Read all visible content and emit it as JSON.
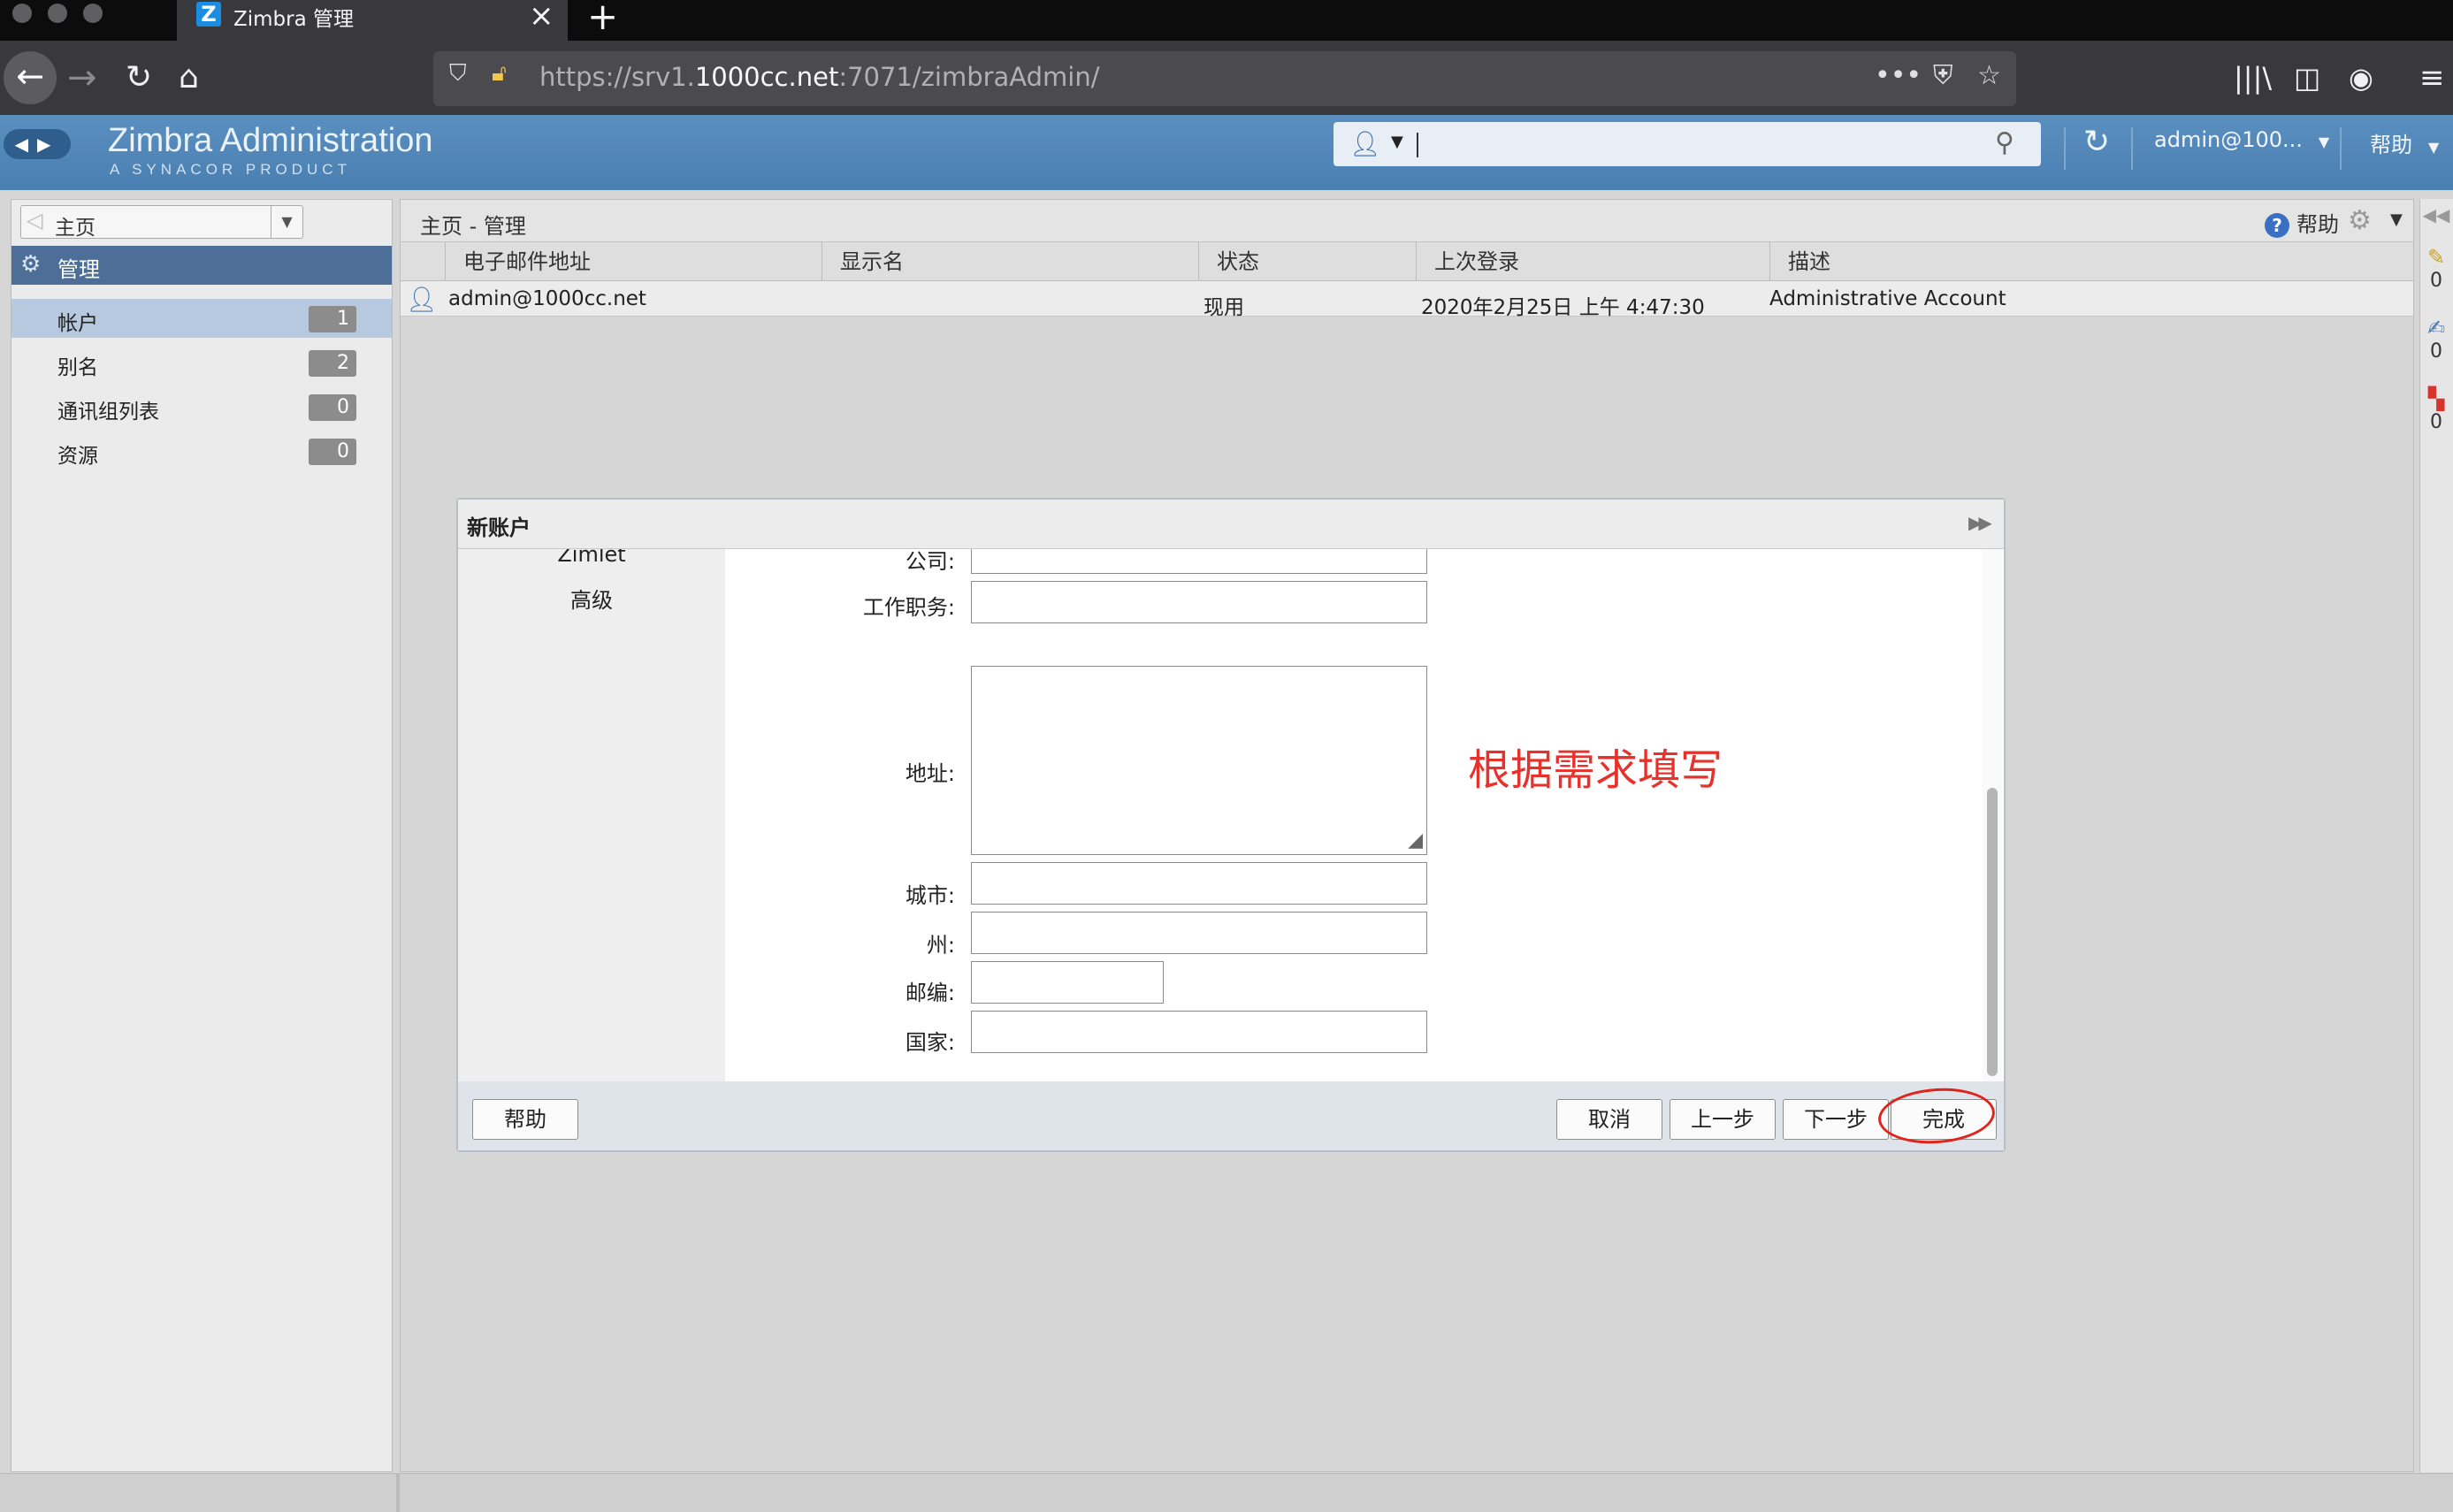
{
  "browser": {
    "tab_title": "Zimbra 管理",
    "tab_favicon": "Z",
    "url_prefix": "https://srv1.",
    "url_domain": "1000cc.net",
    "url_suffix": ":7071/zimbraAdmin/"
  },
  "header": {
    "logo": "Zimbra Administration",
    "logo_sub": "A SYNACOR PRODUCT",
    "search_value": "",
    "user": "admin@100...",
    "help": "帮助"
  },
  "sidebar": {
    "home_select": "主页",
    "section": "管理",
    "items": [
      {
        "label": "帐户",
        "count": "1",
        "selected": true
      },
      {
        "label": "别名",
        "count": "2",
        "selected": false
      },
      {
        "label": "通讯组列表",
        "count": "0",
        "selected": false
      },
      {
        "label": "资源",
        "count": "0",
        "selected": false
      }
    ]
  },
  "main": {
    "breadcrumb": "主页 - 管理",
    "help": "帮助",
    "columns": [
      "电子邮件地址",
      "显示名",
      "状态",
      "上次登录",
      "描述"
    ],
    "rows": [
      {
        "email": "admin@1000cc.net",
        "display_name": "",
        "status": "现用",
        "last_login": "2020年2月25日 上午 4:47:30",
        "description": "Administrative Account"
      }
    ]
  },
  "right_rail": [
    "0",
    "0",
    "0"
  ],
  "dialog": {
    "title": "新账户",
    "nav_items": [
      "Zimlet",
      "高级"
    ],
    "fields": {
      "company": "公司:",
      "job_title": "工作职务:",
      "address": "地址:",
      "city": "城市:",
      "state": "州:",
      "zip": "邮编:",
      "country": "国家:"
    },
    "values": {
      "company": "",
      "job_title": "",
      "address": "",
      "city": "",
      "state": "",
      "zip": "",
      "country": ""
    },
    "annotation": "根据需求填写",
    "buttons": {
      "help": "帮助",
      "cancel": "取消",
      "prev": "上一步",
      "next": "下一步",
      "finish": "完成"
    }
  },
  "colors": {
    "zimbra_header": "#4f84b6",
    "nav_selected": "#b7c9de",
    "annotation": "#e8312a"
  }
}
